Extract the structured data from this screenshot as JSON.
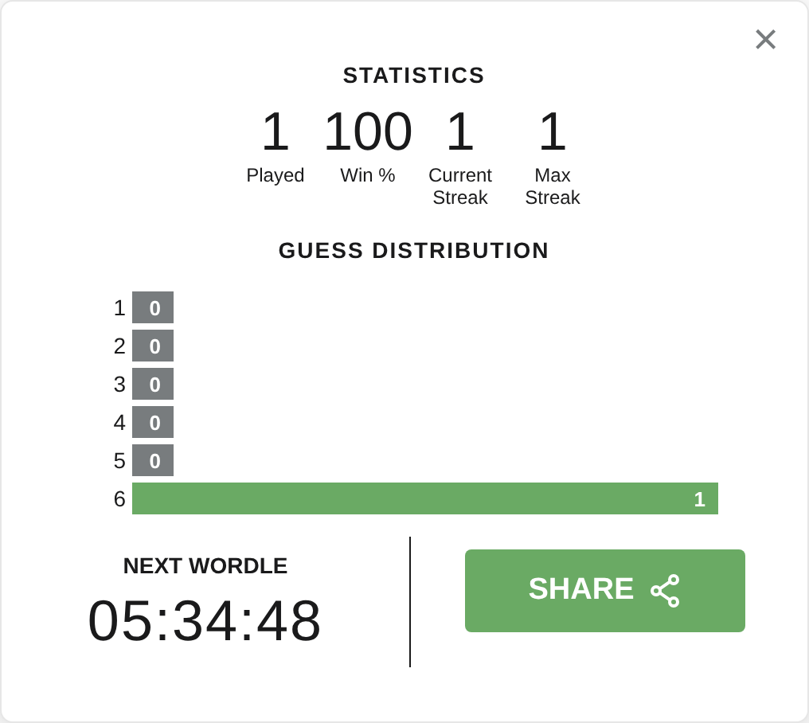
{
  "close": "×",
  "title": "STATISTICS",
  "stats": [
    {
      "value": "1",
      "label": "Played"
    },
    {
      "value": "100",
      "label": "Win %"
    },
    {
      "value": "1",
      "label": "Current Streak"
    },
    {
      "value": "1",
      "label": "Max Streak"
    }
  ],
  "distribution_title": "GUESS DISTRIBUTION",
  "distribution": [
    {
      "guess": "1",
      "count": "0",
      "level": 0,
      "highlighted": false
    },
    {
      "guess": "2",
      "count": "0",
      "level": 0,
      "highlighted": false
    },
    {
      "guess": "3",
      "count": "0",
      "level": 0,
      "highlighted": false
    },
    {
      "guess": "4",
      "count": "0",
      "level": 0,
      "highlighted": false
    },
    {
      "guess": "5",
      "count": "0",
      "level": 0,
      "highlighted": false
    },
    {
      "guess": "6",
      "count": "1",
      "level": 1,
      "highlighted": true
    }
  ],
  "next_label": "NEXT WORDLE",
  "timer": "05:34:48",
  "share_button": "SHARE"
}
